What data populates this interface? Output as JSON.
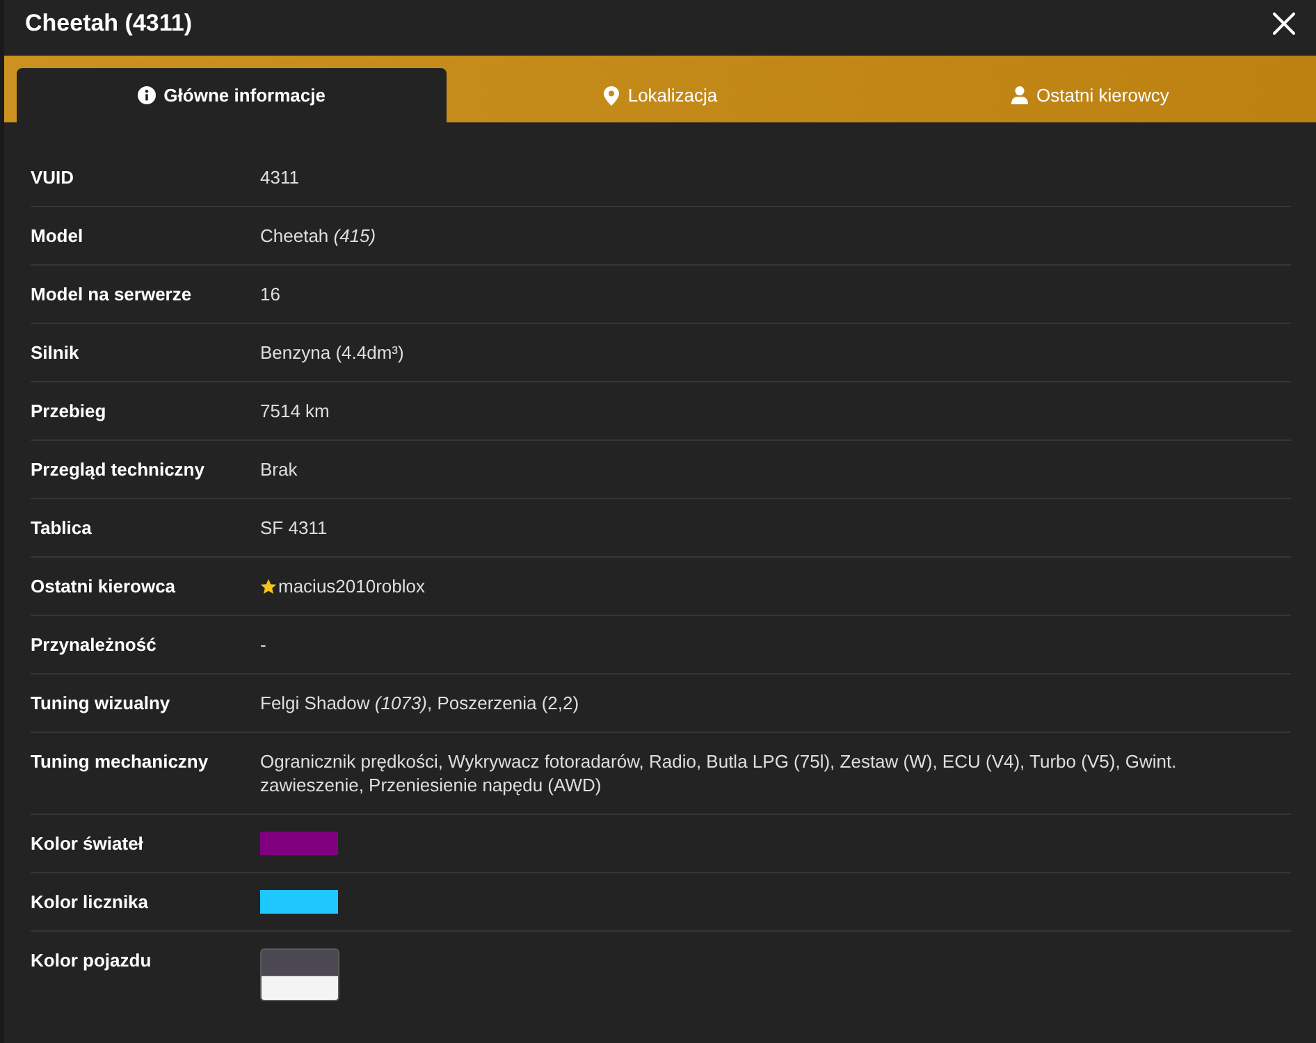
{
  "window": {
    "title": "Cheetah (4311)"
  },
  "tabs": [
    {
      "label": "Główne informacje",
      "selected": true
    },
    {
      "label": "Lokalizacja",
      "selected": false
    },
    {
      "label": "Ostatni kierowcy",
      "selected": false
    }
  ],
  "rows": [
    {
      "kind": "text",
      "label": "VUID",
      "value": "4311"
    },
    {
      "kind": "text",
      "label": "Model",
      "value": "Cheetah *(415)*"
    },
    {
      "kind": "text",
      "label": "Model na serwerze",
      "value": "16"
    },
    {
      "kind": "text",
      "label": "Silnik",
      "value": "Benzyna (4.4dm³)"
    },
    {
      "kind": "text",
      "label": "Przebieg",
      "value": "7514 km"
    },
    {
      "kind": "text",
      "label": "Przegląd techniczny",
      "value": "Brak"
    },
    {
      "kind": "text",
      "label": "Tablica",
      "value": "SF 4311"
    },
    {
      "kind": "player",
      "label": "Ostatni kierowca",
      "value": "macius2010roblox"
    },
    {
      "kind": "text",
      "label": "Przynależność",
      "value": "-"
    },
    {
      "kind": "text",
      "label": "Tuning wizualny",
      "value": "Felgi Shadow *(1073)*, Poszerzenia (2,2)"
    },
    {
      "kind": "text",
      "label": "Tuning mechaniczny",
      "value": "Ogranicznik prędkości, Wykrywacz fotoradarów, Radio, Butla LPG (75l), Zestaw (W), ECU (V4), Turbo (V5), Gwint. zawieszenie, Przeniesienie napędu (AWD)"
    },
    {
      "kind": "swatch",
      "label": "Kolor świateł",
      "swatches": [
        {
          "color": "#800080"
        }
      ]
    },
    {
      "kind": "swatch",
      "label": "Kolor licznika",
      "swatches": [
        {
          "color": "#1ec8ff"
        }
      ]
    },
    {
      "kind": "swatch",
      "label": "Kolor pojazdu",
      "swatches": [
        {
          "color": "#4b4851"
        },
        {
          "color": "#f4f4f4"
        }
      ]
    }
  ]
}
